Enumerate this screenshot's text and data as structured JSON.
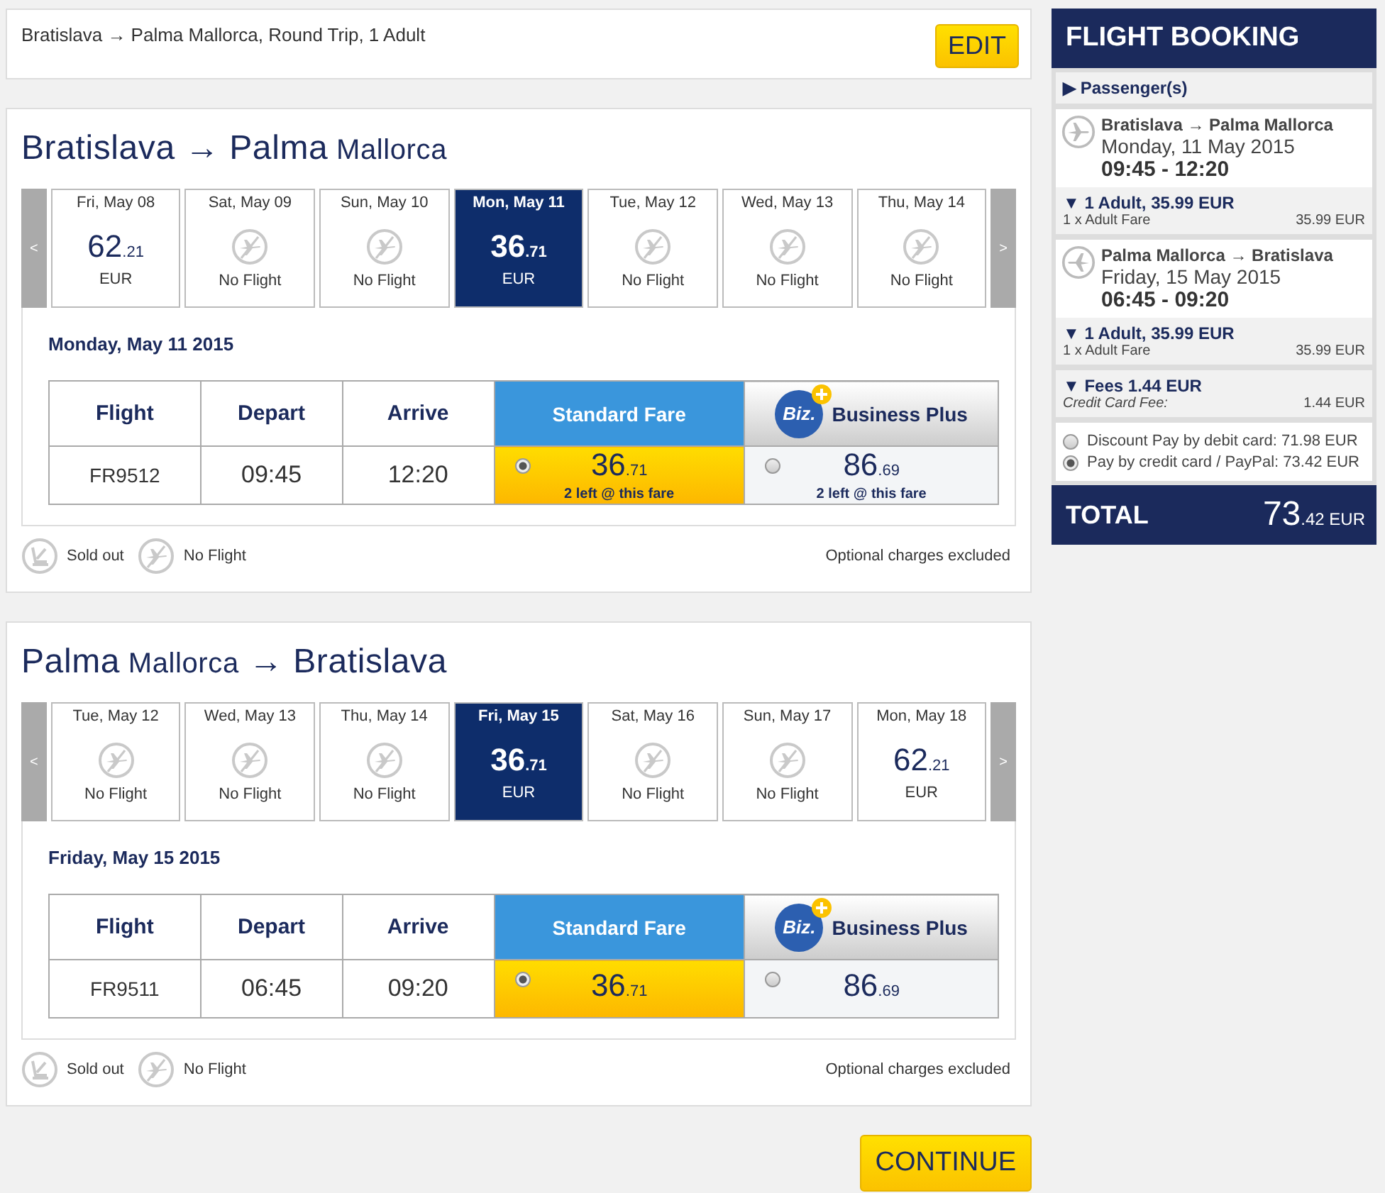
{
  "search_summary": {
    "text": "Bratislava → Palma Mallorca, Round Trip, 1 Adult",
    "edit_label": "EDIT"
  },
  "journeys": [
    {
      "title_parts": [
        {
          "text": "Bratislava",
          "small": false
        },
        {
          "text": "→",
          "small": false
        },
        {
          "text": "Palma",
          "small": false
        },
        {
          "text": "Mallorca",
          "small": true
        }
      ],
      "prev": "<",
      "next": ">",
      "days": [
        {
          "label": "Fri, May 08",
          "kind": "price",
          "whole": "62",
          "cents": ".21",
          "currency": "EUR",
          "selected": false
        },
        {
          "label": "Sat, May 09",
          "kind": "no_flight",
          "text": "No Flight",
          "selected": false
        },
        {
          "label": "Sun, May 10",
          "kind": "no_flight",
          "text": "No Flight",
          "selected": false
        },
        {
          "label": "Mon, May 11",
          "kind": "price",
          "whole": "36",
          "cents": ".71",
          "currency": "EUR",
          "selected": true
        },
        {
          "label": "Tue, May 12",
          "kind": "no_flight",
          "text": "No Flight",
          "selected": false
        },
        {
          "label": "Wed, May 13",
          "kind": "no_flight",
          "text": "No Flight",
          "selected": false
        },
        {
          "label": "Thu, May 14",
          "kind": "no_flight",
          "text": "No Flight",
          "selected": false
        }
      ],
      "date_heading": "Monday, May 11 2015",
      "columns": [
        "Flight",
        "Depart",
        "Arrive"
      ],
      "fare_headers": [
        {
          "kind": "standard",
          "label": "Standard Fare"
        },
        {
          "kind": "business",
          "label": "Business Plus",
          "logo": "Biz."
        }
      ],
      "flight": {
        "number": "FR9512",
        "depart": "09:45",
        "arrive": "12:20"
      },
      "fares": [
        {
          "kind": "standard",
          "whole": "36",
          "cents": ".71",
          "seats": "2 left @ this fare",
          "selected": true
        },
        {
          "kind": "business",
          "whole": "86",
          "cents": ".69",
          "seats": "2 left @ this fare",
          "selected": false
        }
      ],
      "legend": [
        {
          "kind": "sold_out",
          "label": "Sold out"
        },
        {
          "kind": "no_flight",
          "label": "No Flight"
        }
      ],
      "note": "Optional charges excluded"
    },
    {
      "title_parts": [
        {
          "text": "Palma",
          "small": false
        },
        {
          "text": "Mallorca",
          "small": true
        },
        {
          "text": "→",
          "small": false
        },
        {
          "text": "Bratislava",
          "small": false
        }
      ],
      "prev": "<",
      "next": ">",
      "days": [
        {
          "label": "Tue, May 12",
          "kind": "no_flight",
          "text": "No Flight",
          "selected": false
        },
        {
          "label": "Wed, May 13",
          "kind": "no_flight",
          "text": "No Flight",
          "selected": false
        },
        {
          "label": "Thu, May 14",
          "kind": "no_flight",
          "text": "No Flight",
          "selected": false
        },
        {
          "label": "Fri, May 15",
          "kind": "price",
          "whole": "36",
          "cents": ".71",
          "currency": "EUR",
          "selected": true
        },
        {
          "label": "Sat, May 16",
          "kind": "no_flight",
          "text": "No Flight",
          "selected": false
        },
        {
          "label": "Sun, May 17",
          "kind": "no_flight",
          "text": "No Flight",
          "selected": false
        },
        {
          "label": "Mon, May 18",
          "kind": "price",
          "whole": "62",
          "cents": ".21",
          "currency": "EUR",
          "selected": false
        }
      ],
      "date_heading": "Friday, May 15 2015",
      "columns": [
        "Flight",
        "Depart",
        "Arrive"
      ],
      "fare_headers": [
        {
          "kind": "standard",
          "label": "Standard Fare"
        },
        {
          "kind": "business",
          "label": "Business Plus",
          "logo": "Biz."
        }
      ],
      "flight": {
        "number": "FR9511",
        "depart": "06:45",
        "arrive": "09:20"
      },
      "fares": [
        {
          "kind": "standard",
          "whole": "36",
          "cents": ".71",
          "selected": true
        },
        {
          "kind": "business",
          "whole": "86",
          "cents": ".69",
          "selected": false
        }
      ],
      "legend": [
        {
          "kind": "sold_out",
          "label": "Sold out"
        },
        {
          "kind": "no_flight",
          "label": "No Flight"
        }
      ],
      "note": "Optional charges excluded"
    }
  ],
  "continue_label": "CONTINUE",
  "booking": {
    "title": "FLIGHT BOOKING",
    "passengers": {
      "marker": "▶",
      "label": "Passenger(s)",
      "expanded": false
    },
    "segments": [
      {
        "kind": "out",
        "route": "Bratislava → Palma Mallorca",
        "date": "Monday, 11 May 2015",
        "times": "09:45 - 12:20",
        "summary_marker": "▼",
        "summary": "1 Adult, 35.99 EUR",
        "line_label": "1 x Adult Fare",
        "line_amount": "35.99 EUR"
      },
      {
        "kind": "back",
        "route": "Palma Mallorca → Bratislava",
        "date": "Friday, 15 May 2015",
        "times": "06:45 - 09:20",
        "summary_marker": "▼",
        "summary": "1 Adult, 35.99 EUR",
        "line_label": "1 x Adult Fare",
        "line_amount": "35.99 EUR"
      }
    ],
    "fees": {
      "marker": "▼",
      "summary": "Fees 1.44 EUR",
      "line_label": "Credit Card Fee:",
      "line_amount": "1.44 EUR"
    },
    "payment_options": [
      {
        "label": "Discount Pay by debit card: 71.98 EUR",
        "selected": false
      },
      {
        "label": "Pay by credit card / PayPal: 73.42 EUR",
        "selected": true
      }
    ],
    "total_label": "TOTAL",
    "total_whole": "73",
    "total_cents": ".42",
    "total_currency": "EUR"
  }
}
